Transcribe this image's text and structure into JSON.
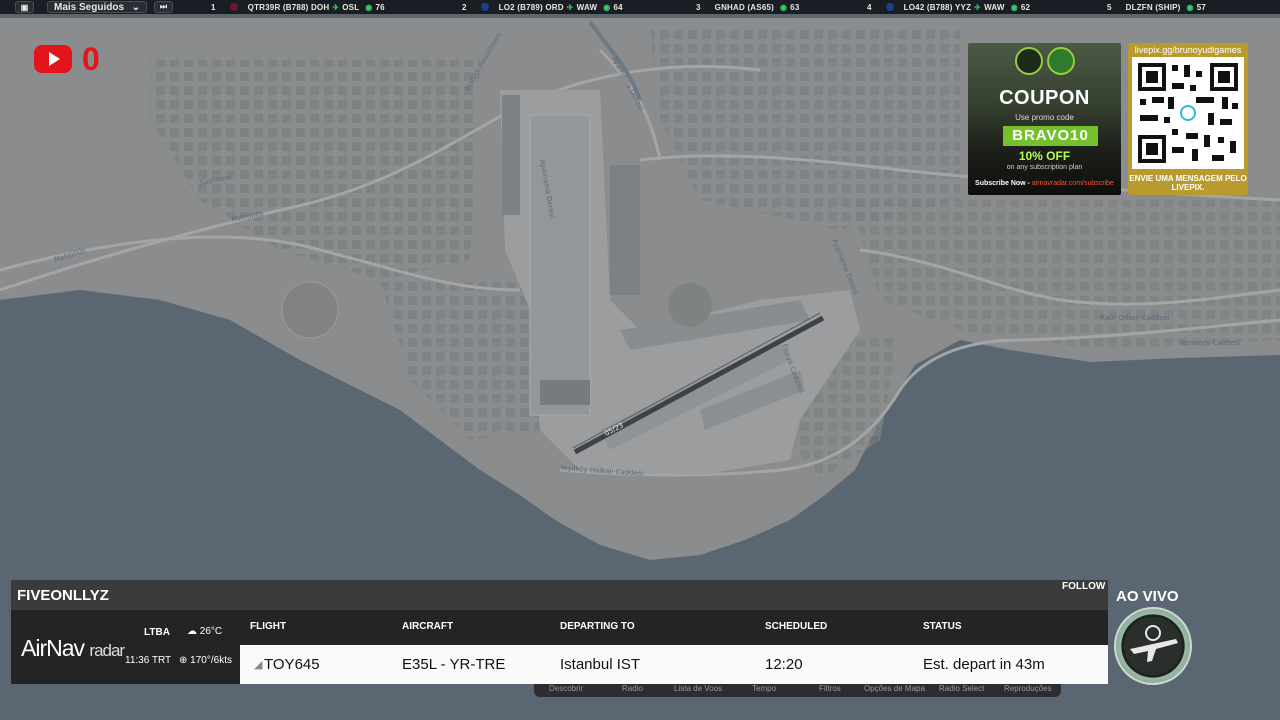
{
  "topbar": {
    "dropdown_label": "Mais Seguidos",
    "rankings": [
      {
        "rank": "1",
        "callsign": "QTR39R",
        "aircraft": "(B788)",
        "from": "DOH",
        "to": "OSL",
        "viewers": "76",
        "color": "#6d1634"
      },
      {
        "rank": "2",
        "callsign": "LO2",
        "aircraft": "(B789)",
        "from": "ORD",
        "to": "WAW",
        "viewers": "64",
        "color": "#1d3f8a"
      },
      {
        "rank": "3",
        "callsign": "GNHAD",
        "aircraft": "(AS65)",
        "from": "",
        "to": "",
        "viewers": "63",
        "color": ""
      },
      {
        "rank": "4",
        "callsign": "LO42",
        "aircraft": "(B788)",
        "from": "YYZ",
        "to": "WAW",
        "viewers": "62",
        "color": "#1d3f8a"
      },
      {
        "rank": "5",
        "callsign": "DLZFN",
        "aircraft": "(SHIP)",
        "from": "",
        "to": "",
        "viewers": "57",
        "color": ""
      }
    ]
  },
  "youtube": {
    "count": "0",
    "color": "#e3141a"
  },
  "coupon": {
    "title": "COUPON",
    "subtitle": "Use promo code",
    "code": "BRAVO10",
    "discount": "10% OFF",
    "note": "on any subscription plan",
    "footer_prefix": "Subscribe Now -",
    "footer_link": "airnavradar.com/subscribe"
  },
  "qr": {
    "url": "livepix.gg/brunoyudigames",
    "message": "ENVIE UMA MENSAGEM PELO LIVEPIX."
  },
  "map": {
    "labels": [
      "Ayamama Deresi",
      "Ayamama Deresi",
      "Ayamama Deresi",
      "Sazlıdere",
      "Metrobüs",
      "Metrobüs",
      "Atatürk Havalimanı",
      "Yeşilköy Halkalı Caddesi",
      "Florya Caddesi",
      "Kennedy Caddesi",
      "Rauf Orbay Caddesi",
      "05/23"
    ]
  },
  "flight": {
    "name": "FIVEONLLYZ",
    "follow": "FOLLOW",
    "airport": "LTBA",
    "local_time": "11:36 TRT",
    "temperature": "26°C",
    "wind": "170°/6kts",
    "columns": {
      "flight": "FLIGHT",
      "aircraft": "AIRCRAFT",
      "departing": "DEPARTING TO",
      "scheduled": "SCHEDULED",
      "status": "STATUS"
    },
    "row": {
      "flight": "TOY645",
      "aircraft": "E35L - YR-TRE",
      "departing": "Istanbul IST",
      "scheduled": "12:20",
      "status": "Est. depart in 43m"
    }
  },
  "brand": {
    "name": "AirNav",
    "suffix": "radar"
  },
  "menu": [
    "Descobrir",
    "Radio",
    "Lista de Voos",
    "Tempo",
    "Filtros",
    "Opções de Mapa",
    "Radio Select",
    "Reproduções"
  ],
  "live": "AO VIVO",
  "colors": {
    "sea": "#5a6772",
    "land": "#8a8c8d",
    "accent_green": "#2fd06b"
  }
}
